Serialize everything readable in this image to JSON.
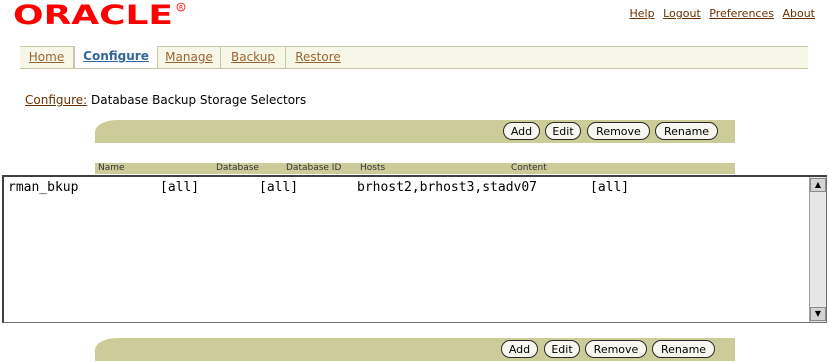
{
  "brand": {
    "logo_text": "ORACLE",
    "logo_color": "#ff0000"
  },
  "global_links": [
    "Help",
    "Logout",
    "Preferences",
    "About"
  ],
  "tabs": [
    {
      "label": "Home"
    },
    {
      "label": "Configure",
      "active": true
    },
    {
      "label": "Manage"
    },
    {
      "label": "Backup"
    },
    {
      "label": "Restore"
    }
  ],
  "breadcrumb": {
    "link": "Configure:",
    "text": "Database Backup Storage Selectors"
  },
  "actions": {
    "add": "Add",
    "edit": "Edit",
    "remove": "Remove",
    "rename": "Rename"
  },
  "columns": [
    "Name",
    "Database",
    "Database ID",
    "Hosts",
    "Content"
  ],
  "rows": [
    {
      "name": "rman_bkup",
      "database": "[all]",
      "database_id": "[all]",
      "hosts": "brhost2,brhost3,stadv07",
      "content": "[all]"
    }
  ],
  "colors": {
    "bar": "#cccc99",
    "tab_bar": "#f7f7e7",
    "link": "#663300",
    "active_tab": "#336699"
  }
}
